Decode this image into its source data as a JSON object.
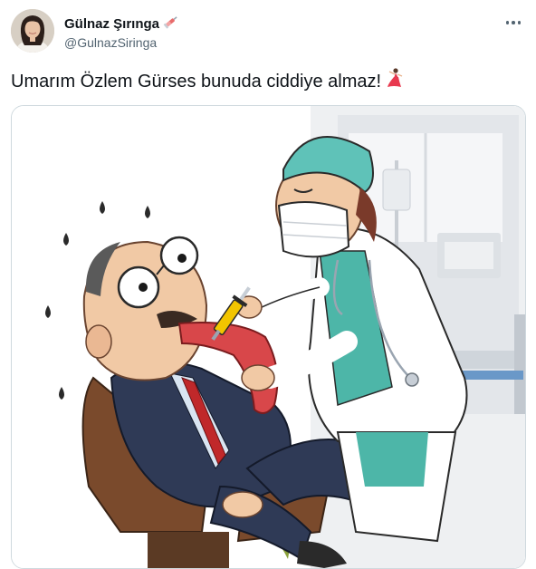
{
  "tweet": {
    "author": {
      "display_name": "Gülnaz Şırınga",
      "handle": "@GulnazSiringa",
      "name_emoji_icon": "syringe-icon",
      "avatar_icon": "avatar"
    },
    "text": "Umarım Özlem Gürses bunuda ciddiye almaz!",
    "text_emoji_icon": "dancer-icon",
    "more_icon": "more-options-icon",
    "media": {
      "kind": "cartoon-illustration",
      "colors": {
        "nurse_cap": "#5fc2b8",
        "nurse_scrubs": "#4db6a8",
        "suit": "#2f3a56",
        "tie": "#c0282a",
        "tongue": "#d8474a",
        "chair": "#7a4a2c",
        "syringe": "#f2c500"
      }
    }
  }
}
